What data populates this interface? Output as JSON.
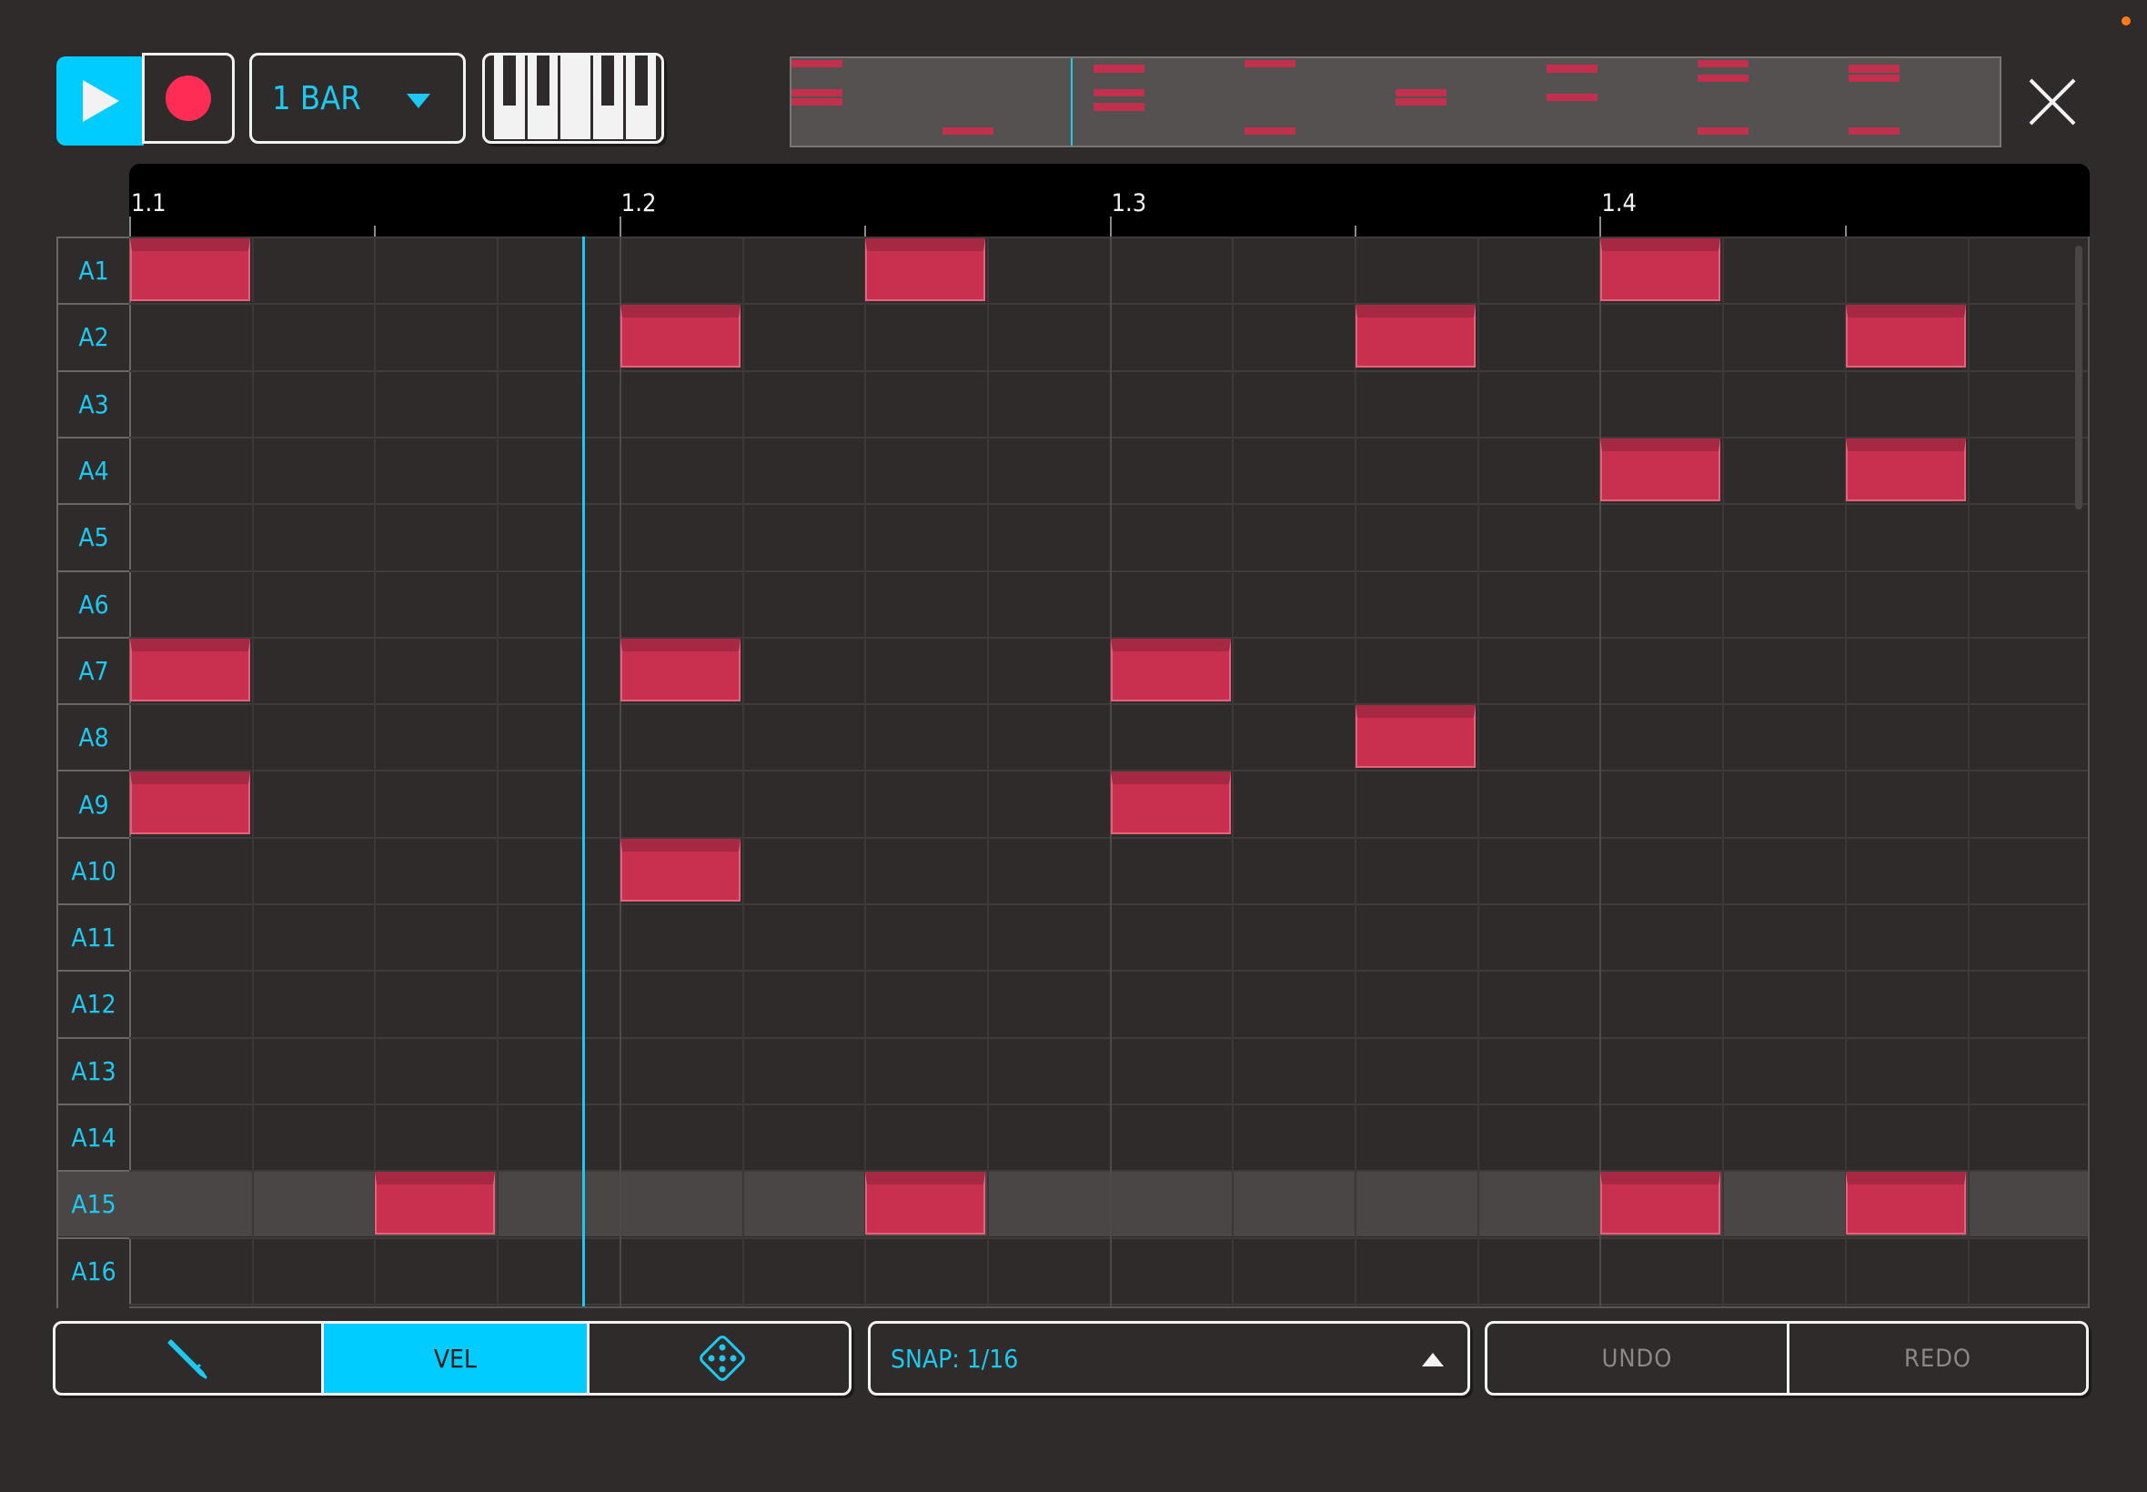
{
  "toolbar": {
    "play_icon": "play-icon",
    "record_icon": "record-icon",
    "length_value": "1 BAR",
    "keys_icon": "piano-keys-icon",
    "close_icon": "close-icon",
    "accent_color": "#00ccff",
    "record_color": "#ff2d55"
  },
  "ruler": {
    "markers": [
      "1.1",
      "1.2",
      "1.3",
      "1.4"
    ]
  },
  "rows": [
    "A1",
    "A2",
    "A3",
    "A4",
    "A5",
    "A6",
    "A7",
    "A8",
    "A9",
    "A10",
    "A11",
    "A12",
    "A13",
    "A14",
    "A15",
    "A16"
  ],
  "selected_row": "A15",
  "notes": [
    {
      "row": 0,
      "step": 0
    },
    {
      "row": 0,
      "step": 6
    },
    {
      "row": 0,
      "step": 12
    },
    {
      "row": 1,
      "step": 4
    },
    {
      "row": 1,
      "step": 10
    },
    {
      "row": 1,
      "step": 14
    },
    {
      "row": 3,
      "step": 12
    },
    {
      "row": 3,
      "step": 14
    },
    {
      "row": 6,
      "step": 0
    },
    {
      "row": 6,
      "step": 4
    },
    {
      "row": 6,
      "step": 8
    },
    {
      "row": 7,
      "step": 10
    },
    {
      "row": 8,
      "step": 0
    },
    {
      "row": 8,
      "step": 8
    },
    {
      "row": 9,
      "step": 4
    },
    {
      "row": 14,
      "step": 2
    },
    {
      "row": 14,
      "step": 6
    },
    {
      "row": 14,
      "step": 12
    },
    {
      "row": 14,
      "step": 14
    }
  ],
  "note_color": "#c92f4f",
  "playhead_step": 3.7,
  "bottom": {
    "pencil_icon": "pencil-icon",
    "vel_label": "VEL",
    "dice_icon": "dice-icon",
    "snap_label": "SNAP: 1/16",
    "undo_label": "UNDO",
    "redo_label": "REDO"
  }
}
